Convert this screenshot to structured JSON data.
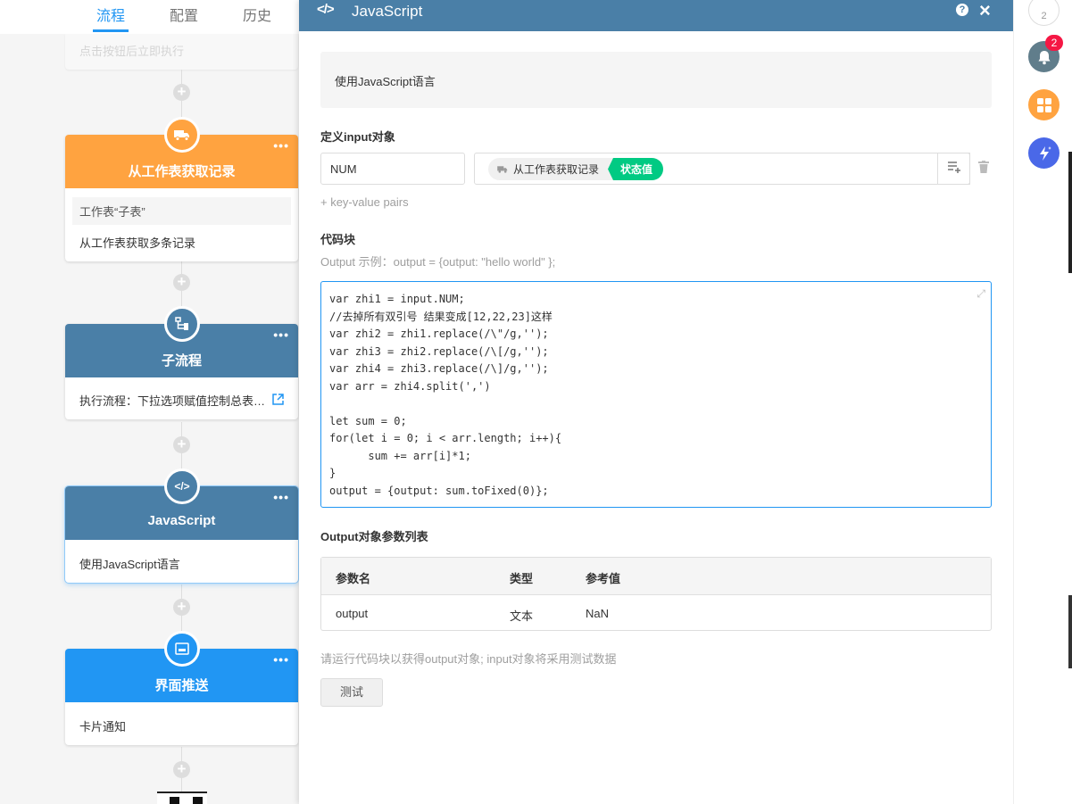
{
  "tabs": [
    "流程",
    "配置",
    "历史"
  ],
  "top_faded_text": "点击按钮后立即执行",
  "nodes": [
    {
      "title": "从工作表获取记录",
      "subtitle": "工作表“子表”",
      "body": "从工作表获取多条记录",
      "color": "#ffa340",
      "icon": "truck-icon",
      "dots": "•••"
    },
    {
      "title": "子流程",
      "body": "执行流程：下拉选项赋值控制总表子表信息",
      "color": "#4a7fa7",
      "icon": "subprocess-icon",
      "dots": "•••"
    },
    {
      "title": "JavaScript",
      "body": "使用JavaScript语言",
      "color": "#4a7fa7",
      "icon": "code-icon",
      "badge": "</>",
      "dots": "•••"
    },
    {
      "title": "界面推送",
      "body": "卡片通知",
      "color": "#2196f3",
      "icon": "card-icon",
      "dots": "•••"
    }
  ],
  "panel": {
    "title": "JavaScript",
    "description": "使用JavaScript语言",
    "input_section_label": "定义input对象",
    "input_key": "NUM",
    "input_value_source": "从工作表获取记录",
    "input_value_field": "状态值",
    "add_pair_label": "+ key-value pairs",
    "code_section_label": "代码块",
    "code_hint": "Output 示例：output = {output: \"hello world\" };",
    "code_lines": [
      "var zhi1 = input.NUM;",
      "//去掉所有双引号 结果变成[12,22,23]这样",
      "var zhi2 = zhi1.replace(/\\\"/g,'');",
      "var zhi3 = zhi2.replace(/\\[/g,'');",
      "var zhi4 = zhi3.replace(/\\]/g,'');",
      "var arr = zhi4.split(',')",
      "",
      "let sum = 0;",
      "for(let i = 0; i < arr.length; i++){",
      "      sum += arr[i]*1;",
      "}",
      "output = {output: sum.toFixed(0)};"
    ],
    "output_section_label": "Output对象参数列表",
    "output_table": {
      "headers": [
        "参数名",
        "类型",
        "参考值"
      ],
      "rows": [
        [
          "output",
          "文本",
          "NaN"
        ]
      ]
    },
    "run_hint": "请运行代码块以获得output对象; input对象将采用测试数据",
    "test_button_label": "测试"
  },
  "rail": {
    "top_count": "2",
    "notification_count": "2"
  },
  "colors": {
    "accent": "#2196f3",
    "header": "#4a7fa7",
    "status_green": "#01ca83",
    "orange": "#ffa340"
  }
}
